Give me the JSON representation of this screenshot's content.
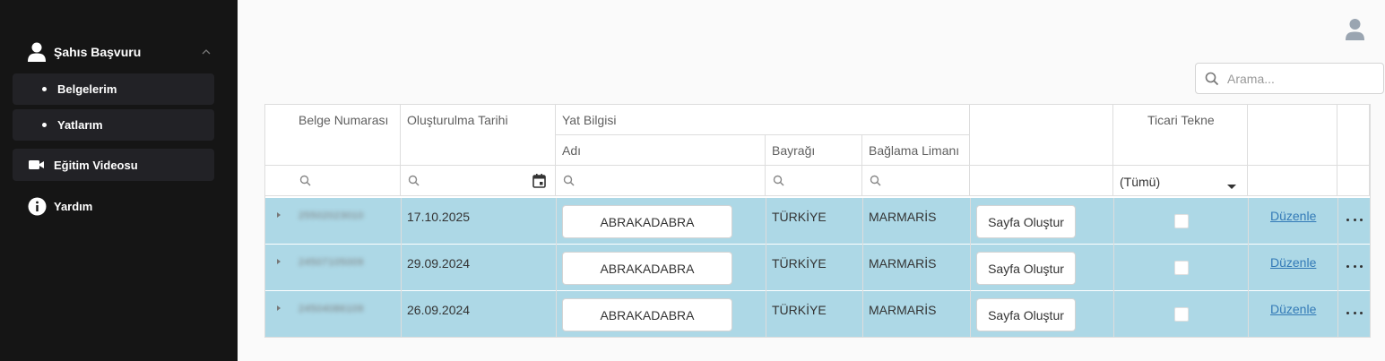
{
  "sidebar": {
    "parent_label": "Şahıs Başvuru",
    "sub_items": [
      {
        "label": "Belgelerim"
      },
      {
        "label": "Yatlarım"
      }
    ],
    "items": [
      {
        "label": "Eğitim Videosu",
        "icon": "video-camera-icon"
      },
      {
        "label": "Yardım",
        "icon": "info-icon"
      }
    ]
  },
  "header": {
    "search_placeholder": "Arama..."
  },
  "grid": {
    "columns": {
      "belge_numarasi": "Belge Numarası",
      "olusturulma_tarihi": "Oluşturulma Tarihi",
      "yat_bilgisi": "Yat Bilgisi",
      "adi": "Adı",
      "bayragi": "Bayrağı",
      "baglama_limani": "Bağlama Limanı",
      "ticari_tekne": "Ticari Tekne"
    },
    "ticari_filter_value": "(Tümü)",
    "rows": [
      {
        "belge_no": "25502023010",
        "tarih": "17.10.2025",
        "adi": "ABRAKADABRA",
        "bayragi": "TÜRKİYE",
        "liman": "MARMARİS",
        "page_button": "Sayfa Oluştur",
        "ticari": false,
        "edit": "Düzenle"
      },
      {
        "belge_no": "24507105009",
        "tarih": "29.09.2024",
        "adi": "ABRAKADABRA",
        "bayragi": "TÜRKİYE",
        "liman": "MARMARİS",
        "page_button": "Sayfa Oluştur",
        "ticari": false,
        "edit": "Düzenle"
      },
      {
        "belge_no": "24504086109",
        "tarih": "26.09.2024",
        "adi": "ABRAKADABRA",
        "bayragi": "TÜRKİYE",
        "liman": "MARMARİS",
        "page_button": "Sayfa Oluştur",
        "ticari": false,
        "edit": "Düzenle"
      }
    ]
  },
  "colors": {
    "sidebar_bg": "#151515",
    "row_bg": "#add8e6",
    "link": "#337ab7"
  }
}
